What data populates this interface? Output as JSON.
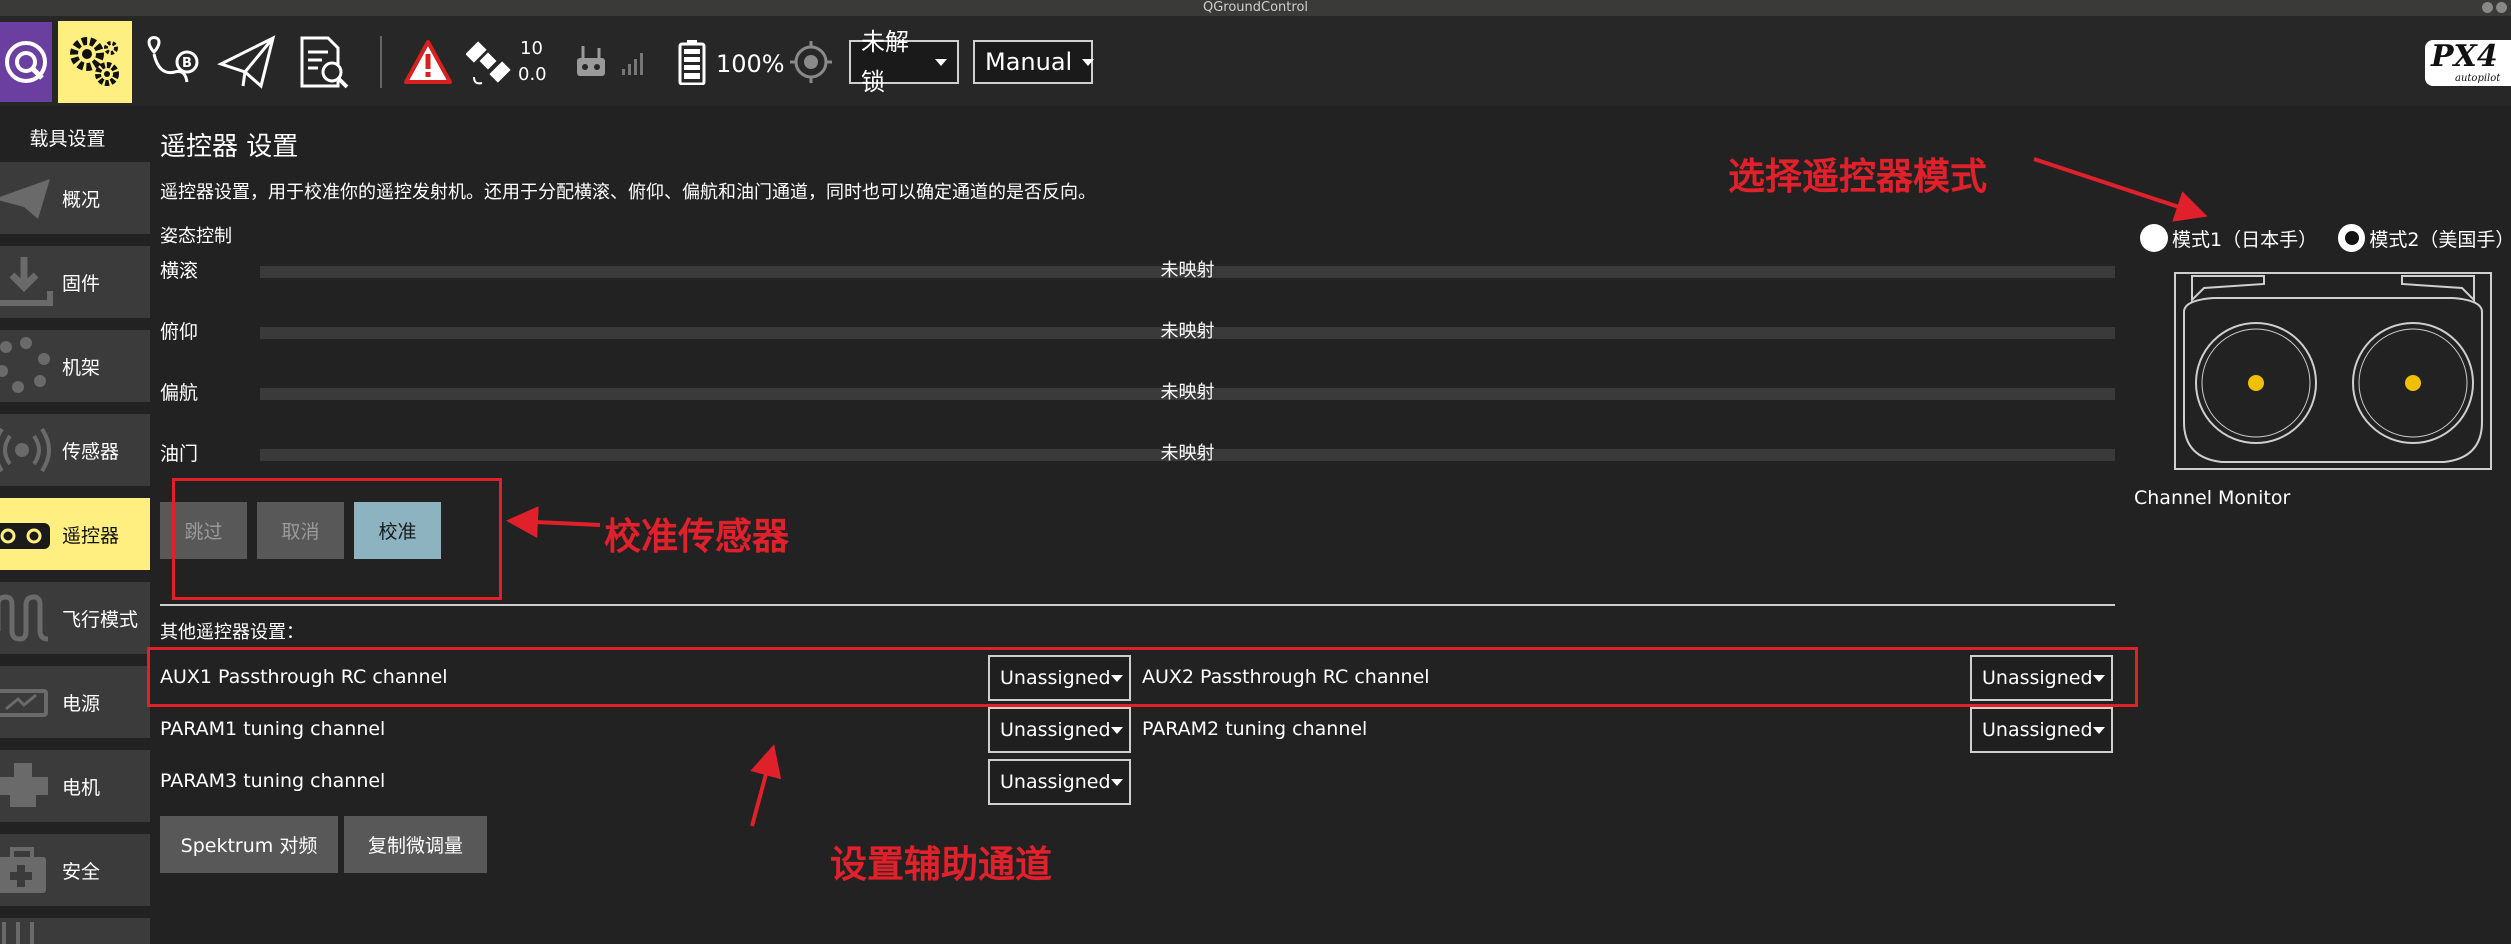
{
  "window": {
    "title": "QGroundControl"
  },
  "toolbar": {
    "gps_count": "10",
    "gps_hdop": "0.0",
    "battery": "100%",
    "arm_status": "未解锁",
    "flight_mode": "Manual",
    "brand_logo": "PX4",
    "brand_sub": "autopilot"
  },
  "sidebar": {
    "title": "载具设置",
    "items": [
      {
        "label": "概况",
        "icon": "paper-plane-icon"
      },
      {
        "label": "固件",
        "icon": "download-icon"
      },
      {
        "label": "机架",
        "icon": "airframe-icon"
      },
      {
        "label": "传感器",
        "icon": "sensor-icon"
      },
      {
        "label": "遥控器",
        "icon": "radio-icon",
        "active": true
      },
      {
        "label": "飞行模式",
        "icon": "flight-modes-icon"
      },
      {
        "label": "电源",
        "icon": "battery-icon"
      },
      {
        "label": "电机",
        "icon": "motor-icon"
      },
      {
        "label": "安全",
        "icon": "safety-icon"
      }
    ]
  },
  "main": {
    "title": "遥控器 设置",
    "description": "遥控器设置，用于校准你的遥控发射机。还用于分配横滚、俯仰、偏航和油门通道，同时也可以确定通道的是否反向。",
    "attitude_label": "姿态控制",
    "axes": [
      {
        "name": "横滚",
        "status": "未映射"
      },
      {
        "name": "俯仰",
        "status": "未映射"
      },
      {
        "name": "偏航",
        "status": "未映射"
      },
      {
        "name": "油门",
        "status": "未映射"
      }
    ],
    "buttons": {
      "skip": "跳过",
      "cancel": "取消",
      "calibrate": "校准"
    },
    "other_label": "其他遥控器设置：",
    "aux": [
      {
        "label": "AUX1 Passthrough RC channel",
        "value": "Unassigned"
      },
      {
        "label": "AUX2 Passthrough RC channel",
        "value": "Unassigned"
      },
      {
        "label": "PARAM1 tuning channel",
        "value": "Unassigned"
      },
      {
        "label": "PARAM2 tuning channel",
        "value": "Unassigned"
      },
      {
        "label": "PARAM3 tuning channel",
        "value": "Unassigned"
      }
    ],
    "spektrum_button": "Spektrum 对频",
    "copy_trims_button": "复制微调量"
  },
  "right_panel": {
    "mode1_label": "模式1（日本手）",
    "mode2_label": "模式2（美国手）",
    "selected_mode": "mode2",
    "channel_monitor": "Channel Monitor"
  },
  "annotations": {
    "select_mode": "选择遥控器模式",
    "calibrate_sensors": "校准传感器",
    "set_aux": "设置辅助通道",
    "color": "#e0202a"
  },
  "colors": {
    "active_highlight": "#ffee80",
    "calibrate_button": "#8cb3bf",
    "background": "#222222",
    "stick_dot": "#f0c000"
  }
}
